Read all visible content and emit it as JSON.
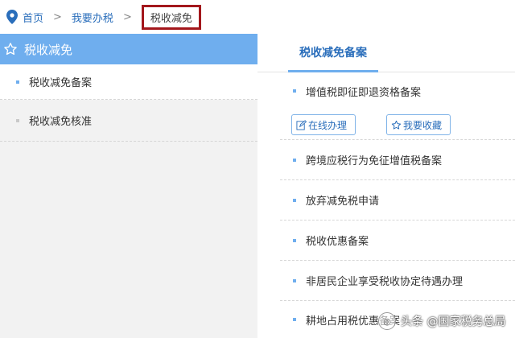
{
  "breadcrumb": {
    "home": "首页",
    "sep1": ">",
    "level2": "我要办税",
    "sep2": ">",
    "current": "税收减免"
  },
  "sidebar": {
    "title": "税收减免",
    "items": [
      {
        "label": "税收减免备案"
      },
      {
        "label": "税收减免核准"
      }
    ]
  },
  "main": {
    "tab": "税收减免备案",
    "first": {
      "label": "增值税即征即退资格备案",
      "online_button": "在线办理",
      "fav_button": "我要收藏"
    },
    "items": [
      {
        "label": "跨境应税行为免征增值税备案"
      },
      {
        "label": "放弃减免税申请"
      },
      {
        "label": "税收优惠备案"
      },
      {
        "label": "非居民企业享受税收协定待遇办理"
      },
      {
        "label": "耕地占用税优惠备案"
      }
    ]
  },
  "watermark": {
    "text": "头条 @国家税务总局"
  },
  "colors": {
    "accent": "#6faeee",
    "link": "#2a6ebb",
    "highlight_border": "#a3171c"
  }
}
